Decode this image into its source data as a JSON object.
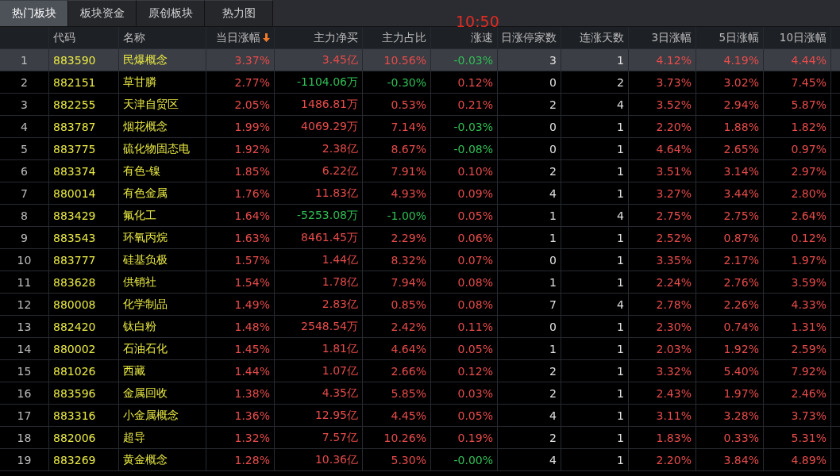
{
  "tabs": [
    {
      "label": "热门板块",
      "selected": true
    },
    {
      "label": "板块资金",
      "selected": false
    },
    {
      "label": "原创板块",
      "selected": false
    },
    {
      "label": "热力图",
      "selected": false
    }
  ],
  "clock": "10:50",
  "table": {
    "columns": [
      {
        "sorted": false
      },
      {
        "label": "代码",
        "sorted": false
      },
      {
        "label": "名称",
        "sorted": false
      },
      {
        "label": "当日涨幅",
        "sorted": true
      },
      {
        "label": "主力净买",
        "sorted": false
      },
      {
        "label": "主力占比",
        "sorted": false
      },
      {
        "label": "涨速",
        "sorted": false
      },
      {
        "label": "日涨停家数",
        "sorted": false
      },
      {
        "label": "连涨天数",
        "sorted": false
      },
      {
        "label": "3日涨幅",
        "sorted": false
      },
      {
        "label": "5日涨幅",
        "sorted": false
      },
      {
        "label": "10日涨幅",
        "sorted": false
      }
    ],
    "rows": [
      {
        "selected": true,
        "index": "1",
        "code": "883590",
        "name": "民爆概念",
        "values": [
          {
            "text": "3.37%",
            "color": "#e84b4b"
          },
          {
            "text": "3.45亿",
            "color": "#e84b4b"
          },
          {
            "text": "10.56%",
            "color": "#e84b4b"
          },
          {
            "text": "-0.03%",
            "color": "#2fbf55"
          },
          {
            "text": "3",
            "color": "#e0e0e0"
          },
          {
            "text": "1",
            "color": "#e0e0e0"
          },
          {
            "text": "4.12%",
            "color": "#e84b4b"
          },
          {
            "text": "4.19%",
            "color": "#e84b4b"
          },
          {
            "text": "4.44%",
            "color": "#e84b4b"
          }
        ]
      },
      {
        "selected": false,
        "index": "2",
        "code": "882151",
        "name": "草甘膦",
        "values": [
          {
            "text": "2.77%",
            "color": "#e84b4b"
          },
          {
            "text": "-1104.06万",
            "color": "#2fbf55"
          },
          {
            "text": "-0.30%",
            "color": "#2fbf55"
          },
          {
            "text": "0.12%",
            "color": "#e84b4b"
          },
          {
            "text": "0",
            "color": "#e0e0e0"
          },
          {
            "text": "2",
            "color": "#e0e0e0"
          },
          {
            "text": "3.73%",
            "color": "#e84b4b"
          },
          {
            "text": "3.02%",
            "color": "#e84b4b"
          },
          {
            "text": "7.45%",
            "color": "#e84b4b"
          }
        ]
      },
      {
        "selected": false,
        "index": "3",
        "code": "882255",
        "name": "天津自贸区",
        "values": [
          {
            "text": "2.05%",
            "color": "#e84b4b"
          },
          {
            "text": "1486.81万",
            "color": "#e84b4b"
          },
          {
            "text": "0.53%",
            "color": "#e84b4b"
          },
          {
            "text": "0.21%",
            "color": "#e84b4b"
          },
          {
            "text": "2",
            "color": "#e0e0e0"
          },
          {
            "text": "4",
            "color": "#e0e0e0"
          },
          {
            "text": "3.52%",
            "color": "#e84b4b"
          },
          {
            "text": "2.94%",
            "color": "#e84b4b"
          },
          {
            "text": "5.87%",
            "color": "#e84b4b"
          }
        ]
      },
      {
        "selected": false,
        "index": "4",
        "code": "883787",
        "name": "烟花概念",
        "values": [
          {
            "text": "1.99%",
            "color": "#e84b4b"
          },
          {
            "text": "4069.29万",
            "color": "#e84b4b"
          },
          {
            "text": "7.14%",
            "color": "#e84b4b"
          },
          {
            "text": "-0.03%",
            "color": "#2fbf55"
          },
          {
            "text": "0",
            "color": "#e0e0e0"
          },
          {
            "text": "1",
            "color": "#e0e0e0"
          },
          {
            "text": "2.20%",
            "color": "#e84b4b"
          },
          {
            "text": "1.88%",
            "color": "#e84b4b"
          },
          {
            "text": "1.82%",
            "color": "#e84b4b"
          }
        ]
      },
      {
        "selected": false,
        "index": "5",
        "code": "883775",
        "name": "硫化物固态电",
        "values": [
          {
            "text": "1.92%",
            "color": "#e84b4b"
          },
          {
            "text": "2.38亿",
            "color": "#e84b4b"
          },
          {
            "text": "8.67%",
            "color": "#e84b4b"
          },
          {
            "text": "-0.08%",
            "color": "#2fbf55"
          },
          {
            "text": "0",
            "color": "#e0e0e0"
          },
          {
            "text": "1",
            "color": "#e0e0e0"
          },
          {
            "text": "4.64%",
            "color": "#e84b4b"
          },
          {
            "text": "2.65%",
            "color": "#e84b4b"
          },
          {
            "text": "0.97%",
            "color": "#e84b4b"
          }
        ]
      },
      {
        "selected": false,
        "index": "6",
        "code": "883374",
        "name": "有色-镍",
        "values": [
          {
            "text": "1.85%",
            "color": "#e84b4b"
          },
          {
            "text": "6.22亿",
            "color": "#e84b4b"
          },
          {
            "text": "7.91%",
            "color": "#e84b4b"
          },
          {
            "text": "0.10%",
            "color": "#e84b4b"
          },
          {
            "text": "2",
            "color": "#e0e0e0"
          },
          {
            "text": "1",
            "color": "#e0e0e0"
          },
          {
            "text": "3.51%",
            "color": "#e84b4b"
          },
          {
            "text": "3.14%",
            "color": "#e84b4b"
          },
          {
            "text": "2.97%",
            "color": "#e84b4b"
          }
        ]
      },
      {
        "selected": false,
        "index": "7",
        "code": "880014",
        "name": "有色金属",
        "values": [
          {
            "text": "1.76%",
            "color": "#e84b4b"
          },
          {
            "text": "11.83亿",
            "color": "#e84b4b"
          },
          {
            "text": "4.93%",
            "color": "#e84b4b"
          },
          {
            "text": "0.09%",
            "color": "#e84b4b"
          },
          {
            "text": "4",
            "color": "#e0e0e0"
          },
          {
            "text": "1",
            "color": "#e0e0e0"
          },
          {
            "text": "3.27%",
            "color": "#e84b4b"
          },
          {
            "text": "3.44%",
            "color": "#e84b4b"
          },
          {
            "text": "2.80%",
            "color": "#e84b4b"
          }
        ]
      },
      {
        "selected": false,
        "index": "8",
        "code": "883429",
        "name": "氟化工",
        "values": [
          {
            "text": "1.64%",
            "color": "#e84b4b"
          },
          {
            "text": "-5253.08万",
            "color": "#2fbf55"
          },
          {
            "text": "-1.00%",
            "color": "#2fbf55"
          },
          {
            "text": "0.05%",
            "color": "#e84b4b"
          },
          {
            "text": "1",
            "color": "#e0e0e0"
          },
          {
            "text": "4",
            "color": "#e0e0e0"
          },
          {
            "text": "2.75%",
            "color": "#e84b4b"
          },
          {
            "text": "2.75%",
            "color": "#e84b4b"
          },
          {
            "text": "2.64%",
            "color": "#e84b4b"
          }
        ]
      },
      {
        "selected": false,
        "index": "9",
        "code": "883543",
        "name": "环氧丙烷",
        "values": [
          {
            "text": "1.63%",
            "color": "#e84b4b"
          },
          {
            "text": "8461.45万",
            "color": "#e84b4b"
          },
          {
            "text": "2.29%",
            "color": "#e84b4b"
          },
          {
            "text": "0.06%",
            "color": "#e84b4b"
          },
          {
            "text": "1",
            "color": "#e0e0e0"
          },
          {
            "text": "1",
            "color": "#e0e0e0"
          },
          {
            "text": "2.52%",
            "color": "#e84b4b"
          },
          {
            "text": "0.87%",
            "color": "#e84b4b"
          },
          {
            "text": "0.12%",
            "color": "#e84b4b"
          }
        ]
      },
      {
        "selected": false,
        "index": "10",
        "code": "883777",
        "name": "硅基负极",
        "values": [
          {
            "text": "1.57%",
            "color": "#e84b4b"
          },
          {
            "text": "1.44亿",
            "color": "#e84b4b"
          },
          {
            "text": "8.32%",
            "color": "#e84b4b"
          },
          {
            "text": "0.07%",
            "color": "#e84b4b"
          },
          {
            "text": "0",
            "color": "#e0e0e0"
          },
          {
            "text": "1",
            "color": "#e0e0e0"
          },
          {
            "text": "3.35%",
            "color": "#e84b4b"
          },
          {
            "text": "2.17%",
            "color": "#e84b4b"
          },
          {
            "text": "1.97%",
            "color": "#e84b4b"
          }
        ]
      },
      {
        "selected": false,
        "index": "11",
        "code": "883628",
        "name": "供销社",
        "values": [
          {
            "text": "1.54%",
            "color": "#e84b4b"
          },
          {
            "text": "1.78亿",
            "color": "#e84b4b"
          },
          {
            "text": "7.94%",
            "color": "#e84b4b"
          },
          {
            "text": "0.08%",
            "color": "#e84b4b"
          },
          {
            "text": "1",
            "color": "#e0e0e0"
          },
          {
            "text": "1",
            "color": "#e0e0e0"
          },
          {
            "text": "2.24%",
            "color": "#e84b4b"
          },
          {
            "text": "2.76%",
            "color": "#e84b4b"
          },
          {
            "text": "3.59%",
            "color": "#e84b4b"
          }
        ]
      },
      {
        "selected": false,
        "index": "12",
        "code": "880008",
        "name": "化学制品",
        "values": [
          {
            "text": "1.49%",
            "color": "#e84b4b"
          },
          {
            "text": "2.83亿",
            "color": "#e84b4b"
          },
          {
            "text": "0.85%",
            "color": "#e84b4b"
          },
          {
            "text": "0.08%",
            "color": "#e84b4b"
          },
          {
            "text": "7",
            "color": "#e0e0e0"
          },
          {
            "text": "4",
            "color": "#e0e0e0"
          },
          {
            "text": "2.78%",
            "color": "#e84b4b"
          },
          {
            "text": "2.26%",
            "color": "#e84b4b"
          },
          {
            "text": "4.33%",
            "color": "#e84b4b"
          }
        ]
      },
      {
        "selected": false,
        "index": "13",
        "code": "882420",
        "name": "钛白粉",
        "values": [
          {
            "text": "1.48%",
            "color": "#e84b4b"
          },
          {
            "text": "2548.54万",
            "color": "#e84b4b"
          },
          {
            "text": "2.42%",
            "color": "#e84b4b"
          },
          {
            "text": "0.11%",
            "color": "#e84b4b"
          },
          {
            "text": "0",
            "color": "#e0e0e0"
          },
          {
            "text": "1",
            "color": "#e0e0e0"
          },
          {
            "text": "2.30%",
            "color": "#e84b4b"
          },
          {
            "text": "0.74%",
            "color": "#e84b4b"
          },
          {
            "text": "1.31%",
            "color": "#e84b4b"
          }
        ]
      },
      {
        "selected": false,
        "index": "14",
        "code": "880002",
        "name": "石油石化",
        "values": [
          {
            "text": "1.45%",
            "color": "#e84b4b"
          },
          {
            "text": "1.81亿",
            "color": "#e84b4b"
          },
          {
            "text": "4.64%",
            "color": "#e84b4b"
          },
          {
            "text": "0.05%",
            "color": "#e84b4b"
          },
          {
            "text": "1",
            "color": "#e0e0e0"
          },
          {
            "text": "1",
            "color": "#e0e0e0"
          },
          {
            "text": "2.03%",
            "color": "#e84b4b"
          },
          {
            "text": "1.92%",
            "color": "#e84b4b"
          },
          {
            "text": "2.59%",
            "color": "#e84b4b"
          }
        ]
      },
      {
        "selected": false,
        "index": "15",
        "code": "881026",
        "name": "西藏",
        "values": [
          {
            "text": "1.44%",
            "color": "#e84b4b"
          },
          {
            "text": "1.07亿",
            "color": "#e84b4b"
          },
          {
            "text": "2.66%",
            "color": "#e84b4b"
          },
          {
            "text": "0.12%",
            "color": "#e84b4b"
          },
          {
            "text": "2",
            "color": "#e0e0e0"
          },
          {
            "text": "1",
            "color": "#e0e0e0"
          },
          {
            "text": "3.32%",
            "color": "#e84b4b"
          },
          {
            "text": "5.40%",
            "color": "#e84b4b"
          },
          {
            "text": "7.92%",
            "color": "#e84b4b"
          }
        ]
      },
      {
        "selected": false,
        "index": "16",
        "code": "883596",
        "name": "金属回收",
        "values": [
          {
            "text": "1.38%",
            "color": "#e84b4b"
          },
          {
            "text": "4.35亿",
            "color": "#e84b4b"
          },
          {
            "text": "5.85%",
            "color": "#e84b4b"
          },
          {
            "text": "0.03%",
            "color": "#e84b4b"
          },
          {
            "text": "2",
            "color": "#e0e0e0"
          },
          {
            "text": "1",
            "color": "#e0e0e0"
          },
          {
            "text": "2.43%",
            "color": "#e84b4b"
          },
          {
            "text": "1.97%",
            "color": "#e84b4b"
          },
          {
            "text": "2.46%",
            "color": "#e84b4b"
          }
        ]
      },
      {
        "selected": false,
        "index": "17",
        "code": "883316",
        "name": "小金属概念",
        "values": [
          {
            "text": "1.36%",
            "color": "#e84b4b"
          },
          {
            "text": "12.95亿",
            "color": "#e84b4b"
          },
          {
            "text": "4.45%",
            "color": "#e84b4b"
          },
          {
            "text": "0.05%",
            "color": "#e84b4b"
          },
          {
            "text": "4",
            "color": "#e0e0e0"
          },
          {
            "text": "1",
            "color": "#e0e0e0"
          },
          {
            "text": "3.11%",
            "color": "#e84b4b"
          },
          {
            "text": "3.28%",
            "color": "#e84b4b"
          },
          {
            "text": "3.73%",
            "color": "#e84b4b"
          }
        ]
      },
      {
        "selected": false,
        "index": "18",
        "code": "882006",
        "name": "超导",
        "values": [
          {
            "text": "1.32%",
            "color": "#e84b4b"
          },
          {
            "text": "7.57亿",
            "color": "#e84b4b"
          },
          {
            "text": "10.26%",
            "color": "#e84b4b"
          },
          {
            "text": "0.19%",
            "color": "#e84b4b"
          },
          {
            "text": "2",
            "color": "#e0e0e0"
          },
          {
            "text": "1",
            "color": "#e0e0e0"
          },
          {
            "text": "1.83%",
            "color": "#e84b4b"
          },
          {
            "text": "0.33%",
            "color": "#e84b4b"
          },
          {
            "text": "5.31%",
            "color": "#e84b4b"
          }
        ]
      },
      {
        "selected": false,
        "index": "19",
        "code": "883269",
        "name": "黄金概念",
        "values": [
          {
            "text": "1.28%",
            "color": "#e84b4b"
          },
          {
            "text": "10.36亿",
            "color": "#e84b4b"
          },
          {
            "text": "5.30%",
            "color": "#e84b4b"
          },
          {
            "text": "-0.00%",
            "color": "#2fbf55"
          },
          {
            "text": "4",
            "color": "#e0e0e0"
          },
          {
            "text": "1",
            "color": "#e0e0e0"
          },
          {
            "text": "2.20%",
            "color": "#e84b4b"
          },
          {
            "text": "3.84%",
            "color": "#e84b4b"
          },
          {
            "text": "4.89%",
            "color": "#e84b4b"
          }
        ]
      }
    ]
  }
}
